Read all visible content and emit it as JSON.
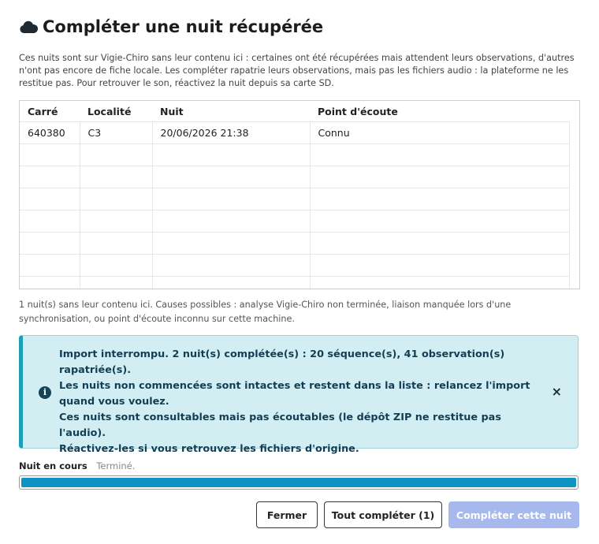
{
  "dialog": {
    "title": "Compléter une nuit récupérée",
    "title_icon": "cloud-icon",
    "intro": "Ces nuits sont sur Vigie-Chiro sans leur contenu ici : certaines ont été récupérées mais attendent leurs observations, d'autres n'ont pas encore de fiche locale. Les compléter rapatrie leurs observations, mais pas les fichiers audio : la plateforme ne les restitue pas. Pour retrouver le son, réactivez la nuit depuis sa carte SD."
  },
  "table": {
    "headers": [
      "Carré",
      "Localité",
      "Nuit",
      "Point d'écoute"
    ],
    "rows": [
      [
        "640380",
        "C3",
        "20/06/2026 21:38",
        "Connu"
      ]
    ]
  },
  "note": "1 nuit(s) sans leur contenu ici. Causes possibles : analyse Vigie-Chiro non terminée, liaison manquée lors d'une synchronisation, ou point d'écoute inconnu sur cette machine.",
  "alert": {
    "icon": "info-icon",
    "lines": [
      "Import interrompu. 2 nuit(s) complétée(s) : 20 séquence(s), 41 observation(s) rapatriée(s).",
      "Les nuits non commencées sont intactes et restent dans la liste : relancez l'import quand vous voulez.",
      "Ces nuits sont consultables mais pas écoutables (le dépôt ZIP ne restitue pas l'audio).",
      "Réactivez-les si vous retrouvez les fichiers d'origine."
    ],
    "close": "×"
  },
  "progress": {
    "label": "Nuit en cours",
    "status": "Terminé.",
    "value": 1.0
  },
  "buttons": {
    "close": "Fermer",
    "complete_all": "Tout compléter (1)",
    "complete_one": "Compléter cette nuit"
  },
  "colors": {
    "alert_bg": "#d3eef2",
    "alert_accent": "#1aa1b8",
    "progress_fill": "#0e93c2",
    "primary_disabled": "#a7b9ec"
  }
}
